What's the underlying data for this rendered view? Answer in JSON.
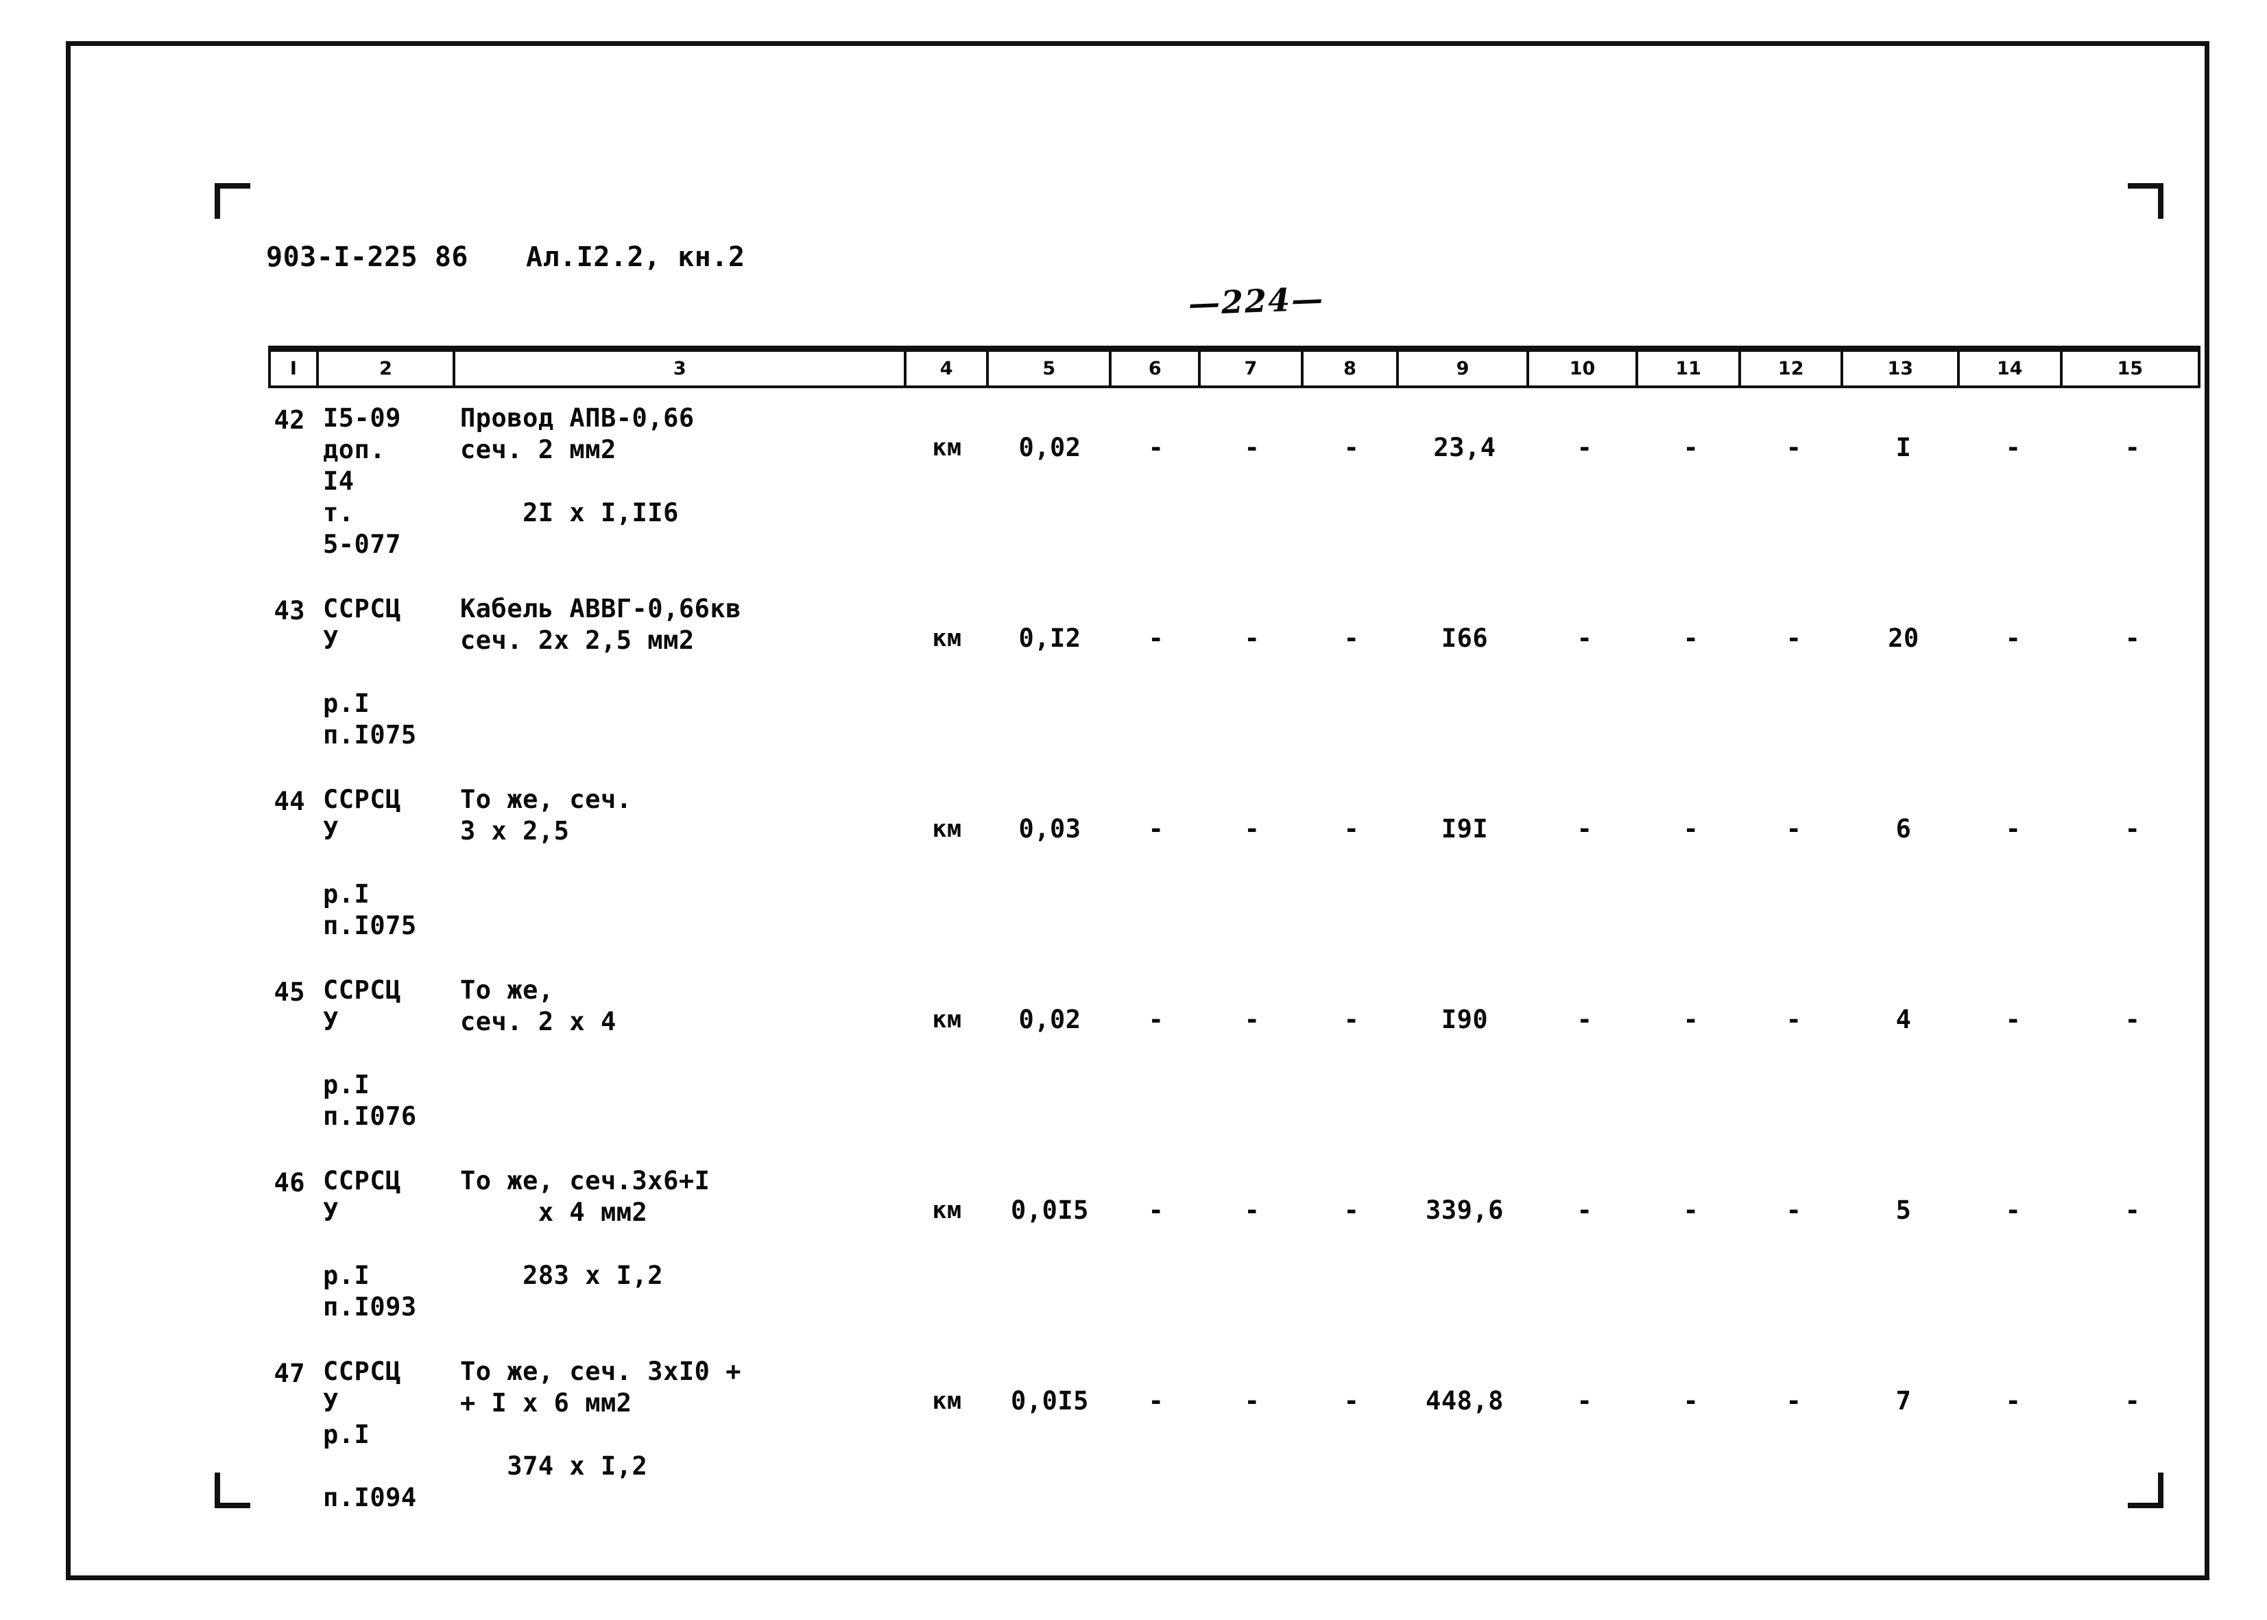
{
  "header": {
    "document_code": "903-I-225 86",
    "album": "Ал.I2.2, кн.2"
  },
  "page_number": "—224—",
  "table": {
    "column_headers": [
      "I",
      "2",
      "3",
      "4",
      "5",
      "6",
      "7",
      "8",
      "9",
      "10",
      "11",
      "12",
      "13",
      "14",
      "15"
    ],
    "rows": [
      {
        "num": "42",
        "code_lines": [
          "I5-09",
          "доп.",
          "I4",
          "т.",
          "5-077"
        ],
        "desc_lines": [
          "Провод АПВ-0,66",
          "сеч. 2 мм2",
          "",
          "    2I x I,II6"
        ],
        "unit": "км",
        "c5": "0,02",
        "c6": "-",
        "c7": "-",
        "c8": "-",
        "c9": "23,4",
        "c10": "-",
        "c11": "-",
        "c12": "-",
        "c13": "I",
        "c14": "-",
        "c15": "-"
      },
      {
        "num": "43",
        "code_lines": [
          "ССРСЦ",
          "У",
          "",
          "р.I",
          "п.I075"
        ],
        "desc_lines": [
          "Кабель АВВГ-0,66кв",
          "сеч. 2х 2,5 мм2"
        ],
        "unit": "км",
        "c5": "0,I2",
        "c6": "-",
        "c7": "-",
        "c8": "-",
        "c9": "I66",
        "c10": "-",
        "c11": "-",
        "c12": "-",
        "c13": "20",
        "c14": "-",
        "c15": "-"
      },
      {
        "num": "44",
        "code_lines": [
          "ССРСЦ",
          "У",
          "",
          "р.I",
          "п.I075"
        ],
        "desc_lines": [
          "То же, сеч.",
          "3 х 2,5"
        ],
        "unit": "км",
        "c5": "0,03",
        "c6": "-",
        "c7": "-",
        "c8": "-",
        "c9": "I9I",
        "c10": "-",
        "c11": "-",
        "c12": "-",
        "c13": "6",
        "c14": "-",
        "c15": "-"
      },
      {
        "num": "45",
        "code_lines": [
          "ССРСЦ",
          "У",
          "",
          "р.I",
          "п.I076"
        ],
        "desc_lines": [
          "То же,",
          "сеч. 2 х 4"
        ],
        "unit": "км",
        "c5": "0,02",
        "c6": "-",
        "c7": "-",
        "c8": "-",
        "c9": "I90",
        "c10": "-",
        "c11": "-",
        "c12": "-",
        "c13": "4",
        "c14": "-",
        "c15": "-"
      },
      {
        "num": "46",
        "code_lines": [
          "ССРСЦ",
          "У",
          "",
          "р.I",
          "п.I093"
        ],
        "desc_lines": [
          "То же, сеч.3х6+I",
          "     х 4 мм2",
          "",
          "    283 х I,2"
        ],
        "unit": "км",
        "c5": "0,0I5",
        "c6": "-",
        "c7": "-",
        "c8": "-",
        "c9": "339,6",
        "c10": "-",
        "c11": "-",
        "c12": "-",
        "c13": "5",
        "c14": "-",
        "c15": "-"
      },
      {
        "num": "47",
        "code_lines": [
          "ССРСЦ",
          "У",
          "р.I",
          "",
          "п.I094"
        ],
        "desc_lines": [
          "То же, сеч. 3хI0 +",
          "+ I х 6 мм2",
          "",
          "   374 х I,2"
        ],
        "unit": "км",
        "c5": "0,0I5",
        "c6": "-",
        "c7": "-",
        "c8": "-",
        "c9": "448,8",
        "c10": "-",
        "c11": "-",
        "c12": "-",
        "c13": "7",
        "c14": "-",
        "c15": "-"
      }
    ]
  }
}
